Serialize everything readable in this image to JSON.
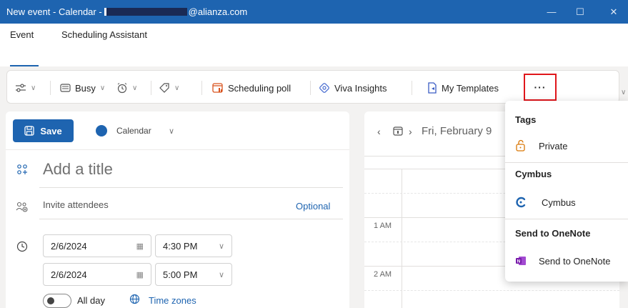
{
  "window": {
    "title_prefix": "New event - Calendar - ",
    "title_suffix": "@alianza.com",
    "minimize": "—",
    "maximize": "☐",
    "close": "✕"
  },
  "tabs": [
    {
      "label": "Event",
      "active": true
    },
    {
      "label": "Scheduling Assistant",
      "active": false
    }
  ],
  "ribbon": {
    "busy_label": "Busy",
    "scheduling_poll_label": "Scheduling poll",
    "viva_insights_label": "Viva Insights",
    "my_templates_label": "My Templates",
    "more_label": "···"
  },
  "form": {
    "save_label": "Save",
    "calendar_label": "Calendar",
    "title_placeholder": "Add a title",
    "invite_placeholder": "Invite attendees",
    "optional_label": "Optional",
    "start_date": "2/6/2024",
    "start_time": "4:30 PM",
    "end_date": "2/6/2024",
    "end_time": "5:00 PM",
    "all_day_label": "All day",
    "time_zones_label": "Time zones"
  },
  "calendar": {
    "date_label": "Fri, February 9",
    "hours": [
      "1 AM",
      "2 AM"
    ]
  },
  "menu": {
    "sections": [
      {
        "header": "Tags",
        "item": "Private"
      },
      {
        "header": "Cymbus",
        "item": "Cymbus"
      },
      {
        "header": "Send to OneNote",
        "item": "Send to OneNote"
      }
    ]
  },
  "colors": {
    "accent": "#1e64b0",
    "highlight": "#e0161b",
    "onenote": "#7719aa",
    "private_icon": "#d97706"
  }
}
